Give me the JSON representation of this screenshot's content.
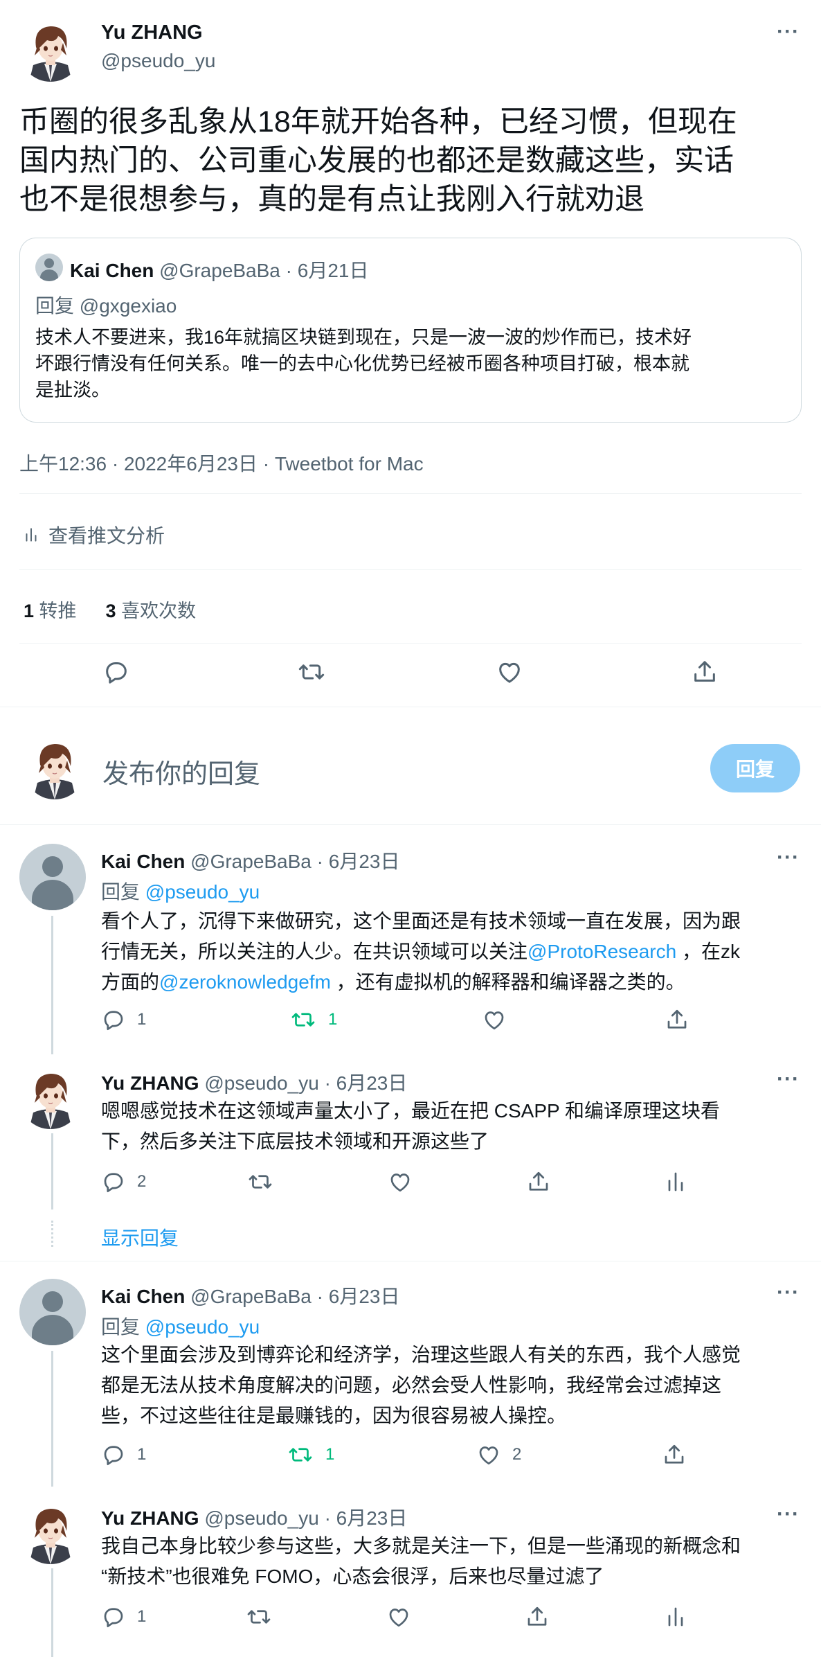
{
  "main_tweet": {
    "author_name": "Yu ZHANG",
    "author_handle": "@pseudo_yu",
    "text_line1": "币圈的很多乱象从18年就开始各种，已经习惯，但现在",
    "text_line2": "国内热门的、公司重心发展的也都还是数藏这些，实话",
    "text_line3": "也不是很想参与，真的是有点让我刚入行就劝退",
    "quote": {
      "author_name": "Kai Chen",
      "author_handle": "@GrapeBaBa",
      "date": "· 6月21日",
      "reply_prefix": "回复",
      "reply_to": "@gxgexiao",
      "line1": "技术人不要进来，我16年就搞区块链到现在，只是一波一波的炒作而已，技术好",
      "line2": "坏跟行情没有任何关系。唯一的去中心化优势已经被币圈各种项目打破，根本就",
      "line3": "是扯淡。"
    },
    "meta": "上午12:36 · 2022年6月23日 · Tweetbot for Mac",
    "analytics": "查看推文分析",
    "retweets_count": "1",
    "retweets_label": "转推",
    "likes_count": "3",
    "likes_label": "喜欢次数"
  },
  "compose": {
    "placeholder": "发布你的回复",
    "button": "回复"
  },
  "replies": [
    {
      "author_name": "Kai Chen",
      "author_handle": "@GrapeBaBa",
      "date": "· 6月23日",
      "reply_prefix": "回复",
      "reply_to": "@pseudo_yu",
      "line1": "看个人了，沉得下来做研究，这个里面还是有技术领域一直在发展，因为跟",
      "line2a": "行情无关，所以关注的人少。在共识领域可以关注",
      "mention1": "@ProtoResearch",
      "line2b": " ，在zk",
      "line3a": "方面的",
      "mention2": "@zeroknowledgefm",
      "line3b": " ，还有虚拟机的解释器和编译器之类的。",
      "replies": "1",
      "retweets": "1",
      "likes": ""
    },
    {
      "author_name": "Yu ZHANG",
      "author_handle": "@pseudo_yu",
      "date": "· 6月23日",
      "line1": "嗯嗯感觉技术在这领域声量太小了，最近在把 CSAPP 和编译原理这块看",
      "line2": "下，然后多关注下底层技术领域和开源这些了",
      "replies": "2",
      "retweets": "",
      "likes": ""
    },
    {
      "author_name": "Kai Chen",
      "author_handle": "@GrapeBaBa",
      "date": "· 6月23日",
      "reply_prefix": "回复",
      "reply_to": "@pseudo_yu",
      "line1": "这个里面会涉及到博弈论和经济学，治理这些跟人有关的东西，我个人感觉",
      "line2": "都是无法从技术角度解决的问题，必然会受人性影响，我经常会过滤掉这",
      "line3": "些，不过这些往往是最赚钱的，因为很容易被人操控。",
      "replies": "1",
      "retweets": "1",
      "likes": "2"
    },
    {
      "author_name": "Yu ZHANG",
      "author_handle": "@pseudo_yu",
      "date": "· 6月23日",
      "line1": "我自己本身比较少参与这些，大多就是关注一下，但是一些涌现的新概念和",
      "line2": "“新技术”也很难免 FOMO，心态会很浮，后来也尽量过滤了",
      "replies": "1",
      "retweets": "",
      "likes": ""
    }
  ],
  "show_replies": "显示回复",
  "colors": {
    "accent": "#1d9bf0",
    "retweet_active": "#00ba7c",
    "muted": "#536471",
    "button_disabled": "#8ecdf8"
  }
}
